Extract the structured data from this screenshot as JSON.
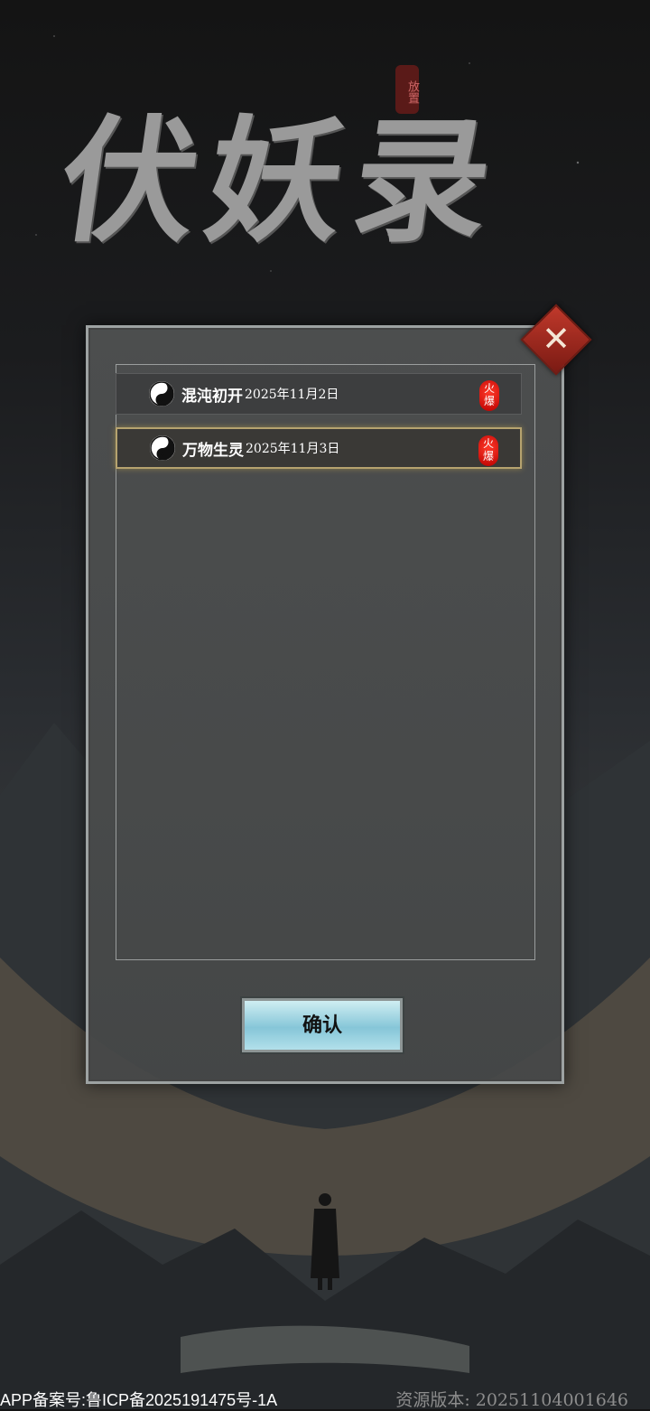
{
  "logo": {
    "title": "伏妖录",
    "seal": "放置"
  },
  "servers": [
    {
      "name": "混沌初开",
      "date": "2025年11月2日",
      "badge": "火爆",
      "selected": false
    },
    {
      "name": "万物生灵",
      "date": "2025年11月3日",
      "badge": "火爆",
      "selected": true
    }
  ],
  "confirm_label": "确认",
  "close_icon": "close-x-icon",
  "footer": {
    "icp": "APP备案号:鲁ICP备2025191475号-1A",
    "version": "资源版本: 20251104001646"
  },
  "colors": {
    "panel": "#4f5151",
    "selected_border": "#b6a36f",
    "hot_badge": "#e0201a",
    "close": "#c0392b",
    "confirm": "#9fd5e3"
  }
}
